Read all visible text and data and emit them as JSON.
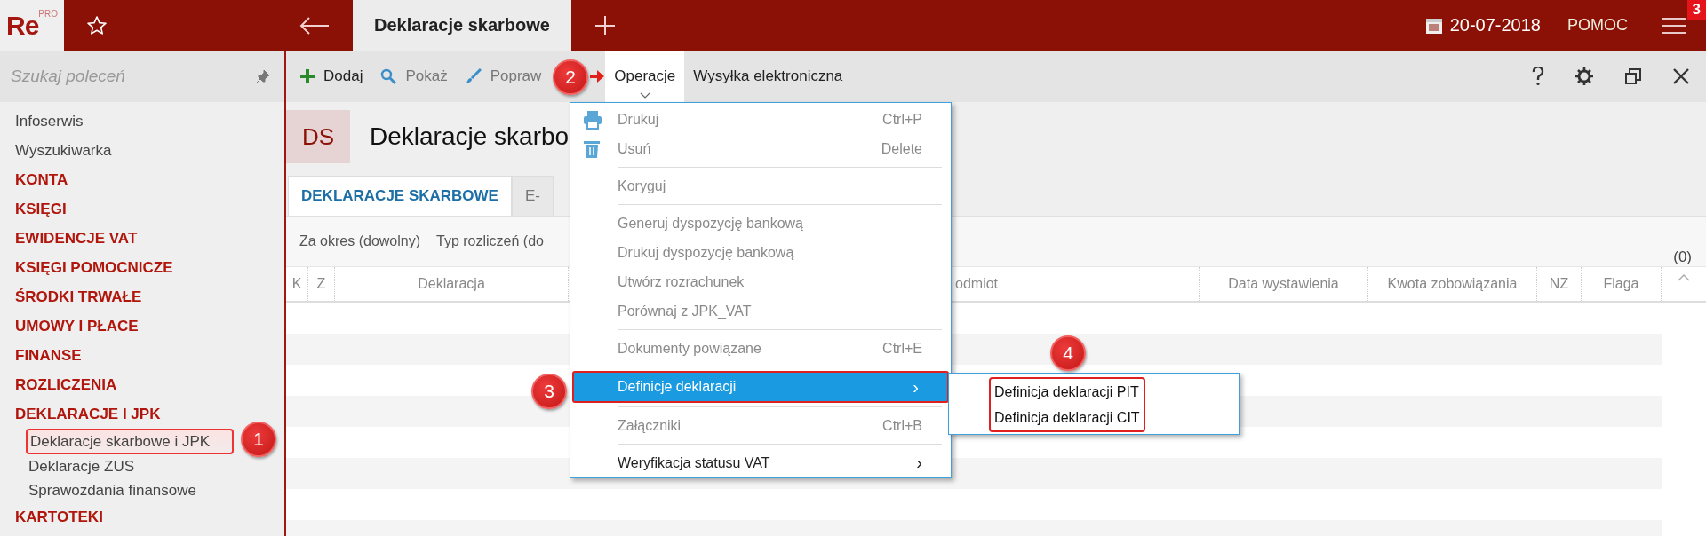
{
  "topbar": {
    "logo": "Re",
    "logo_sup": "PRO",
    "tab": "Deklaracje skarbowe",
    "date": "20-07-2018",
    "help": "POMOC",
    "menu_badge": "3"
  },
  "sidebar": {
    "search_placeholder": "Szukaj poleceń",
    "items": [
      {
        "label": "Infoserwis",
        "kind": "link",
        "outlined": false
      },
      {
        "label": "Wyszukiwarka",
        "kind": "link",
        "outlined": false
      },
      {
        "label": "KONTA",
        "kind": "section",
        "outlined": false
      },
      {
        "label": "KSIĘGI",
        "kind": "section",
        "outlined": false
      },
      {
        "label": "EWIDENCJE VAT",
        "kind": "section",
        "outlined": false
      },
      {
        "label": "KSIĘGI POMOCNICZE",
        "kind": "section",
        "outlined": false
      },
      {
        "label": "ŚRODKI TRWAŁE",
        "kind": "section",
        "outlined": false
      },
      {
        "label": "UMOWY I PŁACE",
        "kind": "section",
        "outlined": false
      },
      {
        "label": "FINANSE",
        "kind": "section",
        "outlined": false
      },
      {
        "label": "ROZLICZENIA",
        "kind": "section",
        "outlined": false
      },
      {
        "label": "DEKLARACJE I JPK",
        "kind": "section",
        "outlined": false
      },
      {
        "label": "Deklaracje skarbowe i JPK",
        "kind": "sub",
        "outlined": true
      },
      {
        "label": "Deklaracje ZUS",
        "kind": "sub",
        "outlined": false
      },
      {
        "label": "Sprawozdania finansowe",
        "kind": "sub",
        "outlined": false
      },
      {
        "label": "KARTOTEKI",
        "kind": "section",
        "outlined": false
      }
    ]
  },
  "toolbar": {
    "items": [
      {
        "label": "Dodaj",
        "disabled": false,
        "selected": false
      },
      {
        "label": "Pokaż",
        "disabled": true,
        "selected": false
      },
      {
        "label": "Popraw",
        "disabled": true,
        "selected": false
      },
      {
        "label": "Operacje",
        "disabled": false,
        "selected": true
      },
      {
        "label": "Wysyłka elektroniczna",
        "disabled": false,
        "selected": false
      }
    ]
  },
  "header": {
    "badge": "DS",
    "title": "Deklaracje skarbo"
  },
  "tabs": [
    {
      "label": "DEKLARACJE SKARBOWE",
      "selected": true
    },
    {
      "label": "E-",
      "selected": false
    }
  ],
  "filters": [
    "Za okres (dowolny)",
    "Typ rozliczeń (do"
  ],
  "count": "(0)",
  "table": {
    "columns": [
      "K",
      "Z",
      "Deklaracja",
      "",
      "odmiot",
      "Data wystawienia",
      "Kwota zobowiązania",
      "NZ",
      "Flaga"
    ]
  },
  "menu": {
    "items": [
      {
        "kind": "command",
        "label": "Drukuj",
        "shortcut": "Ctrl+P",
        "disabled": true,
        "selected": false,
        "outlined": false
      },
      {
        "kind": "command",
        "label": "Usuń",
        "shortcut": "Delete",
        "disabled": true,
        "selected": false,
        "outlined": false
      },
      {
        "kind": "separator"
      },
      {
        "kind": "command",
        "label": "Koryguj",
        "disabled": true,
        "selected": false,
        "outlined": false
      },
      {
        "kind": "separator"
      },
      {
        "kind": "command",
        "label": "Generuj dyspozycję bankową",
        "disabled": true,
        "selected": false,
        "outlined": false
      },
      {
        "kind": "command",
        "label": "Drukuj dyspozycję bankową",
        "disabled": true,
        "selected": false,
        "outlined": false
      },
      {
        "kind": "command",
        "label": "Utwórz rozrachunek",
        "disabled": true,
        "selected": false,
        "outlined": false
      },
      {
        "kind": "command",
        "label": "Porównaj z JPK_VAT",
        "disabled": true,
        "selected": false,
        "outlined": false
      },
      {
        "kind": "separator"
      },
      {
        "kind": "command",
        "label": "Dokumenty powiązane",
        "shortcut": "Ctrl+E",
        "disabled": true,
        "selected": false,
        "outlined": false
      },
      {
        "kind": "separator"
      },
      {
        "kind": "submenu",
        "label": "Definicje deklaracji",
        "arrow": "›",
        "disabled": false,
        "selected": true,
        "outlined": true
      },
      {
        "kind": "separator"
      },
      {
        "kind": "command",
        "label": "Załączniki",
        "shortcut": "Ctrl+B",
        "disabled": true,
        "selected": false,
        "outlined": false
      },
      {
        "kind": "separator"
      },
      {
        "kind": "submenu",
        "label": "Weryfikacja statusu VAT",
        "arrow": "›",
        "disabled": false,
        "selected": false,
        "outlined": false
      }
    ]
  },
  "submenu": {
    "outlined": true,
    "items": [
      "Definicja deklaracji PIT",
      "Definicja deklaracji CIT"
    ]
  },
  "callouts": [
    "1",
    "2",
    "3",
    "4"
  ]
}
